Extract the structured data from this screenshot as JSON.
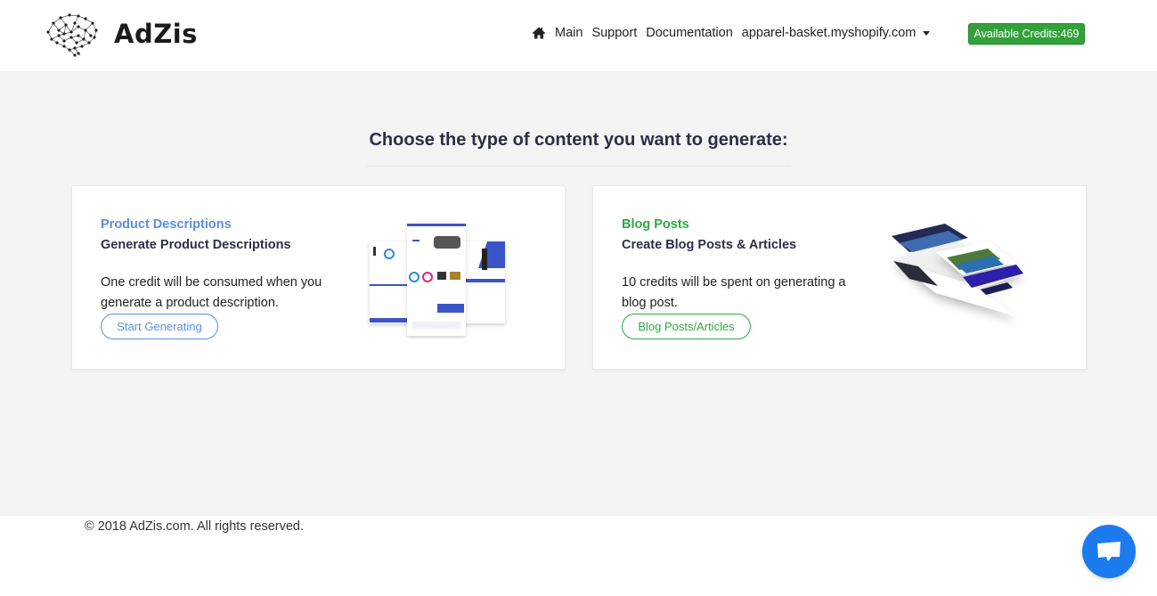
{
  "brand": {
    "name": "AdZis",
    "logo_icon": "brain-network-icon"
  },
  "nav": {
    "home_icon": "home-icon",
    "items": [
      {
        "label": "Main"
      },
      {
        "label": "Support"
      },
      {
        "label": "Documentation"
      }
    ],
    "store_dropdown": {
      "label": "apparel-basket.myshopify.com",
      "icon": "caret-down-icon"
    }
  },
  "credits": {
    "label": "Available Credits:469",
    "value": 469,
    "color": "#32a13a"
  },
  "main": {
    "heading": "Choose the type of content you want to generate:",
    "cards": [
      {
        "label": "Product Descriptions",
        "title": "Generate Product Descriptions",
        "description": "One credit will be consumed when you generate a product description.",
        "button": "Start Generating",
        "accent": "#5b8ee0",
        "illustration": "ecommerce-pages-mockup"
      },
      {
        "label": "Blog Posts",
        "title": "Create Blog Posts & Articles",
        "description": "10 credits will be spent on generating a blog post.",
        "button": "Blog Posts/Articles",
        "accent": "#2eaa44",
        "illustration": "blog-pages-isometric-mockup"
      }
    ]
  },
  "footer": {
    "copyright": "© 2018 AdZis.com. All rights reserved."
  },
  "chat": {
    "icon": "chat-bubble-icon",
    "color": "#1d7bf0"
  }
}
